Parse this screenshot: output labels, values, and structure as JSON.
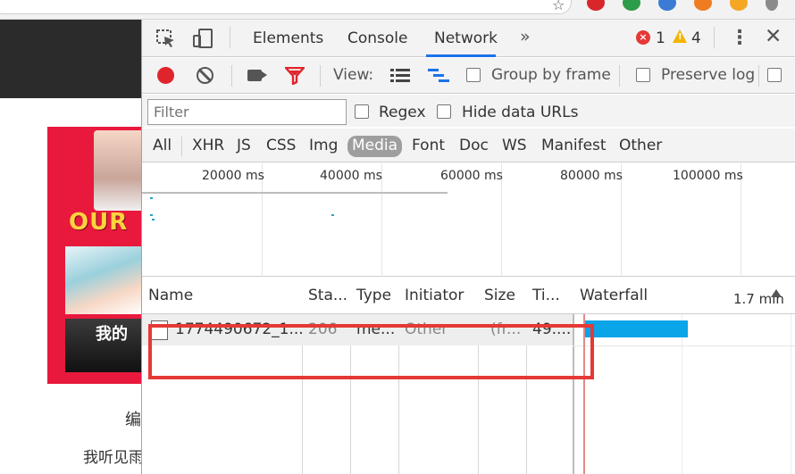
{
  "page": {
    "poster_title": "OUR",
    "poster_cn": "我的",
    "text1": "编",
    "text2": "我听见雨"
  },
  "devtools": {
    "tabs": [
      "Elements",
      "Console",
      "Network"
    ],
    "active_tab": "Network",
    "more_tabs": "»",
    "errors": "1",
    "warnings": "4",
    "menu_label": "⋮",
    "close_label": "✕",
    "toolbar": {
      "view_label": "View:",
      "group_by_frame": "Group by frame",
      "preserve_log": "Preserve log"
    },
    "filter": {
      "placeholder": "Filter",
      "regex_label": "Regex",
      "hide_data_urls_label": "Hide data URLs"
    },
    "types": [
      "All",
      "XHR",
      "JS",
      "CSS",
      "Img",
      "Media",
      "Font",
      "Doc",
      "WS",
      "Manifest",
      "Other"
    ],
    "active_type": "Media",
    "overview": {
      "labels": [
        "20000 ms",
        "40000 ms",
        "60000 ms",
        "80000 ms",
        "100000 ms"
      ]
    },
    "columns": {
      "name": "Name",
      "status": "Sta...",
      "type": "Type",
      "initiator": "Initiator",
      "size": "Size",
      "time": "Ti...",
      "waterfall": "Waterfall",
      "waterfall_scale": "1.7 min"
    },
    "rows": [
      {
        "name": "1774490672_1...",
        "status": "206",
        "type": "me...",
        "initiator": "Other",
        "size": "(fr...",
        "time": "49...."
      }
    ]
  },
  "colors": {
    "highlight": "#e53935",
    "record": "#e0242c",
    "waterfall_bar": "#0aa4e8",
    "active_tab_underline": "#1a73e8"
  },
  "icons": [
    "star-icon",
    "inspect-element-icon",
    "device-toolbar-icon",
    "error-icon",
    "warning-icon",
    "kebab-menu-icon",
    "close-icon",
    "record-icon",
    "clear-icon",
    "screenshot-camera-icon",
    "filter-funnel-icon",
    "list-view-icon",
    "waterfall-view-icon",
    "file-icon",
    "sort-arrow-icon"
  ]
}
